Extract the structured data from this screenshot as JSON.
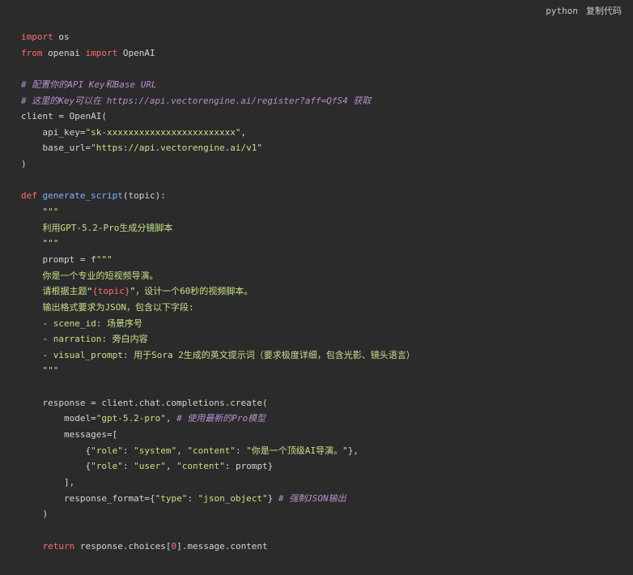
{
  "toolbar": {
    "language": "python",
    "copy_label": "复制代码"
  },
  "colors": {
    "background": "#2b2b2b",
    "keyword": "#ff6b6b",
    "string": "#c5e08a",
    "comment": "#b88fd0",
    "function": "#82b1ff",
    "text": "#d4d4d4"
  },
  "code": {
    "lines": [
      [
        {
          "t": "import",
          "c": "kw"
        },
        {
          "t": " os"
        }
      ],
      [
        {
          "t": "from",
          "c": "kw"
        },
        {
          "t": " openai "
        },
        {
          "t": "import",
          "c": "kw"
        },
        {
          "t": " OpenAI"
        }
      ],
      [],
      [
        {
          "t": "# 配置你的API Key和Base URL",
          "c": "cm"
        }
      ],
      [
        {
          "t": "# 这里的Key可以在 https://api.vectorengine.ai/register?aff=QfS4 获取",
          "c": "cm"
        }
      ],
      [
        {
          "t": "client = OpenAI("
        }
      ],
      [
        {
          "t": "    api_key="
        },
        {
          "t": "\"sk-xxxxxxxxxxxxxxxxxxxxxxxx\"",
          "c": "str"
        },
        {
          "t": ","
        }
      ],
      [
        {
          "t": "    base_url="
        },
        {
          "t": "\"https://api.vectorengine.ai/v1\"",
          "c": "str"
        }
      ],
      [
        {
          "t": ")"
        }
      ],
      [],
      [
        {
          "t": "def",
          "c": "kw"
        },
        {
          "t": " "
        },
        {
          "t": "generate_script",
          "c": "fn"
        },
        {
          "t": "(topic):"
        }
      ],
      [
        {
          "t": "    \"\"\"",
          "c": "str"
        }
      ],
      [
        {
          "t": "    利用GPT-5.2-Pro生成分镜脚本",
          "c": "str"
        }
      ],
      [
        {
          "t": "    \"\"\"",
          "c": "str"
        }
      ],
      [
        {
          "t": "    prompt = f"
        },
        {
          "t": "\"\"\"",
          "c": "str"
        }
      ],
      [
        {
          "t": "    你是一个专业的短视频导演。",
          "c": "str"
        }
      ],
      [
        {
          "t": "    请根据主题“",
          "c": "str"
        },
        {
          "t": "{topic}",
          "c": "num"
        },
        {
          "t": "”，设计一个60秒的视频脚本。",
          "c": "str"
        }
      ],
      [
        {
          "t": "    输出格式要求为JSON，包含以下字段:",
          "c": "str"
        }
      ],
      [
        {
          "t": "    - scene_id: 场景序号",
          "c": "str"
        }
      ],
      [
        {
          "t": "    - narration: 旁白内容",
          "c": "str"
        }
      ],
      [
        {
          "t": "    - visual_prompt: 用于Sora 2生成的英文提示词（要求极度详细，包含光影、镜头语言）",
          "c": "str"
        }
      ],
      [
        {
          "t": "    \"\"\"",
          "c": "str"
        }
      ],
      [],
      [
        {
          "t": "    response = client.chat.completions.create("
        }
      ],
      [
        {
          "t": "        model="
        },
        {
          "t": "\"gpt-5.2-pro\"",
          "c": "str"
        },
        {
          "t": ", "
        },
        {
          "t": "# 使用最新的Pro模型",
          "c": "cm"
        }
      ],
      [
        {
          "t": "        messages=["
        }
      ],
      [
        {
          "t": "            {"
        },
        {
          "t": "\"role\"",
          "c": "str"
        },
        {
          "t": ": "
        },
        {
          "t": "\"system\"",
          "c": "str"
        },
        {
          "t": ", "
        },
        {
          "t": "\"content\"",
          "c": "str"
        },
        {
          "t": ": "
        },
        {
          "t": "\"你是一个顶级AI导演。\"",
          "c": "str"
        },
        {
          "t": "},"
        }
      ],
      [
        {
          "t": "            {"
        },
        {
          "t": "\"role\"",
          "c": "str"
        },
        {
          "t": ": "
        },
        {
          "t": "\"user\"",
          "c": "str"
        },
        {
          "t": ", "
        },
        {
          "t": "\"content\"",
          "c": "str"
        },
        {
          "t": ": prompt}"
        }
      ],
      [
        {
          "t": "        ],"
        }
      ],
      [
        {
          "t": "        response_format={"
        },
        {
          "t": "\"type\"",
          "c": "str"
        },
        {
          "t": ": "
        },
        {
          "t": "\"json_object\"",
          "c": "str"
        },
        {
          "t": "} "
        },
        {
          "t": "# 强制JSON输出",
          "c": "cm"
        }
      ],
      [
        {
          "t": "    )"
        }
      ],
      [],
      [
        {
          "t": "    "
        },
        {
          "t": "return",
          "c": "kw"
        },
        {
          "t": " response.choices["
        },
        {
          "t": "0",
          "c": "num"
        },
        {
          "t": "].message.content"
        }
      ]
    ]
  }
}
